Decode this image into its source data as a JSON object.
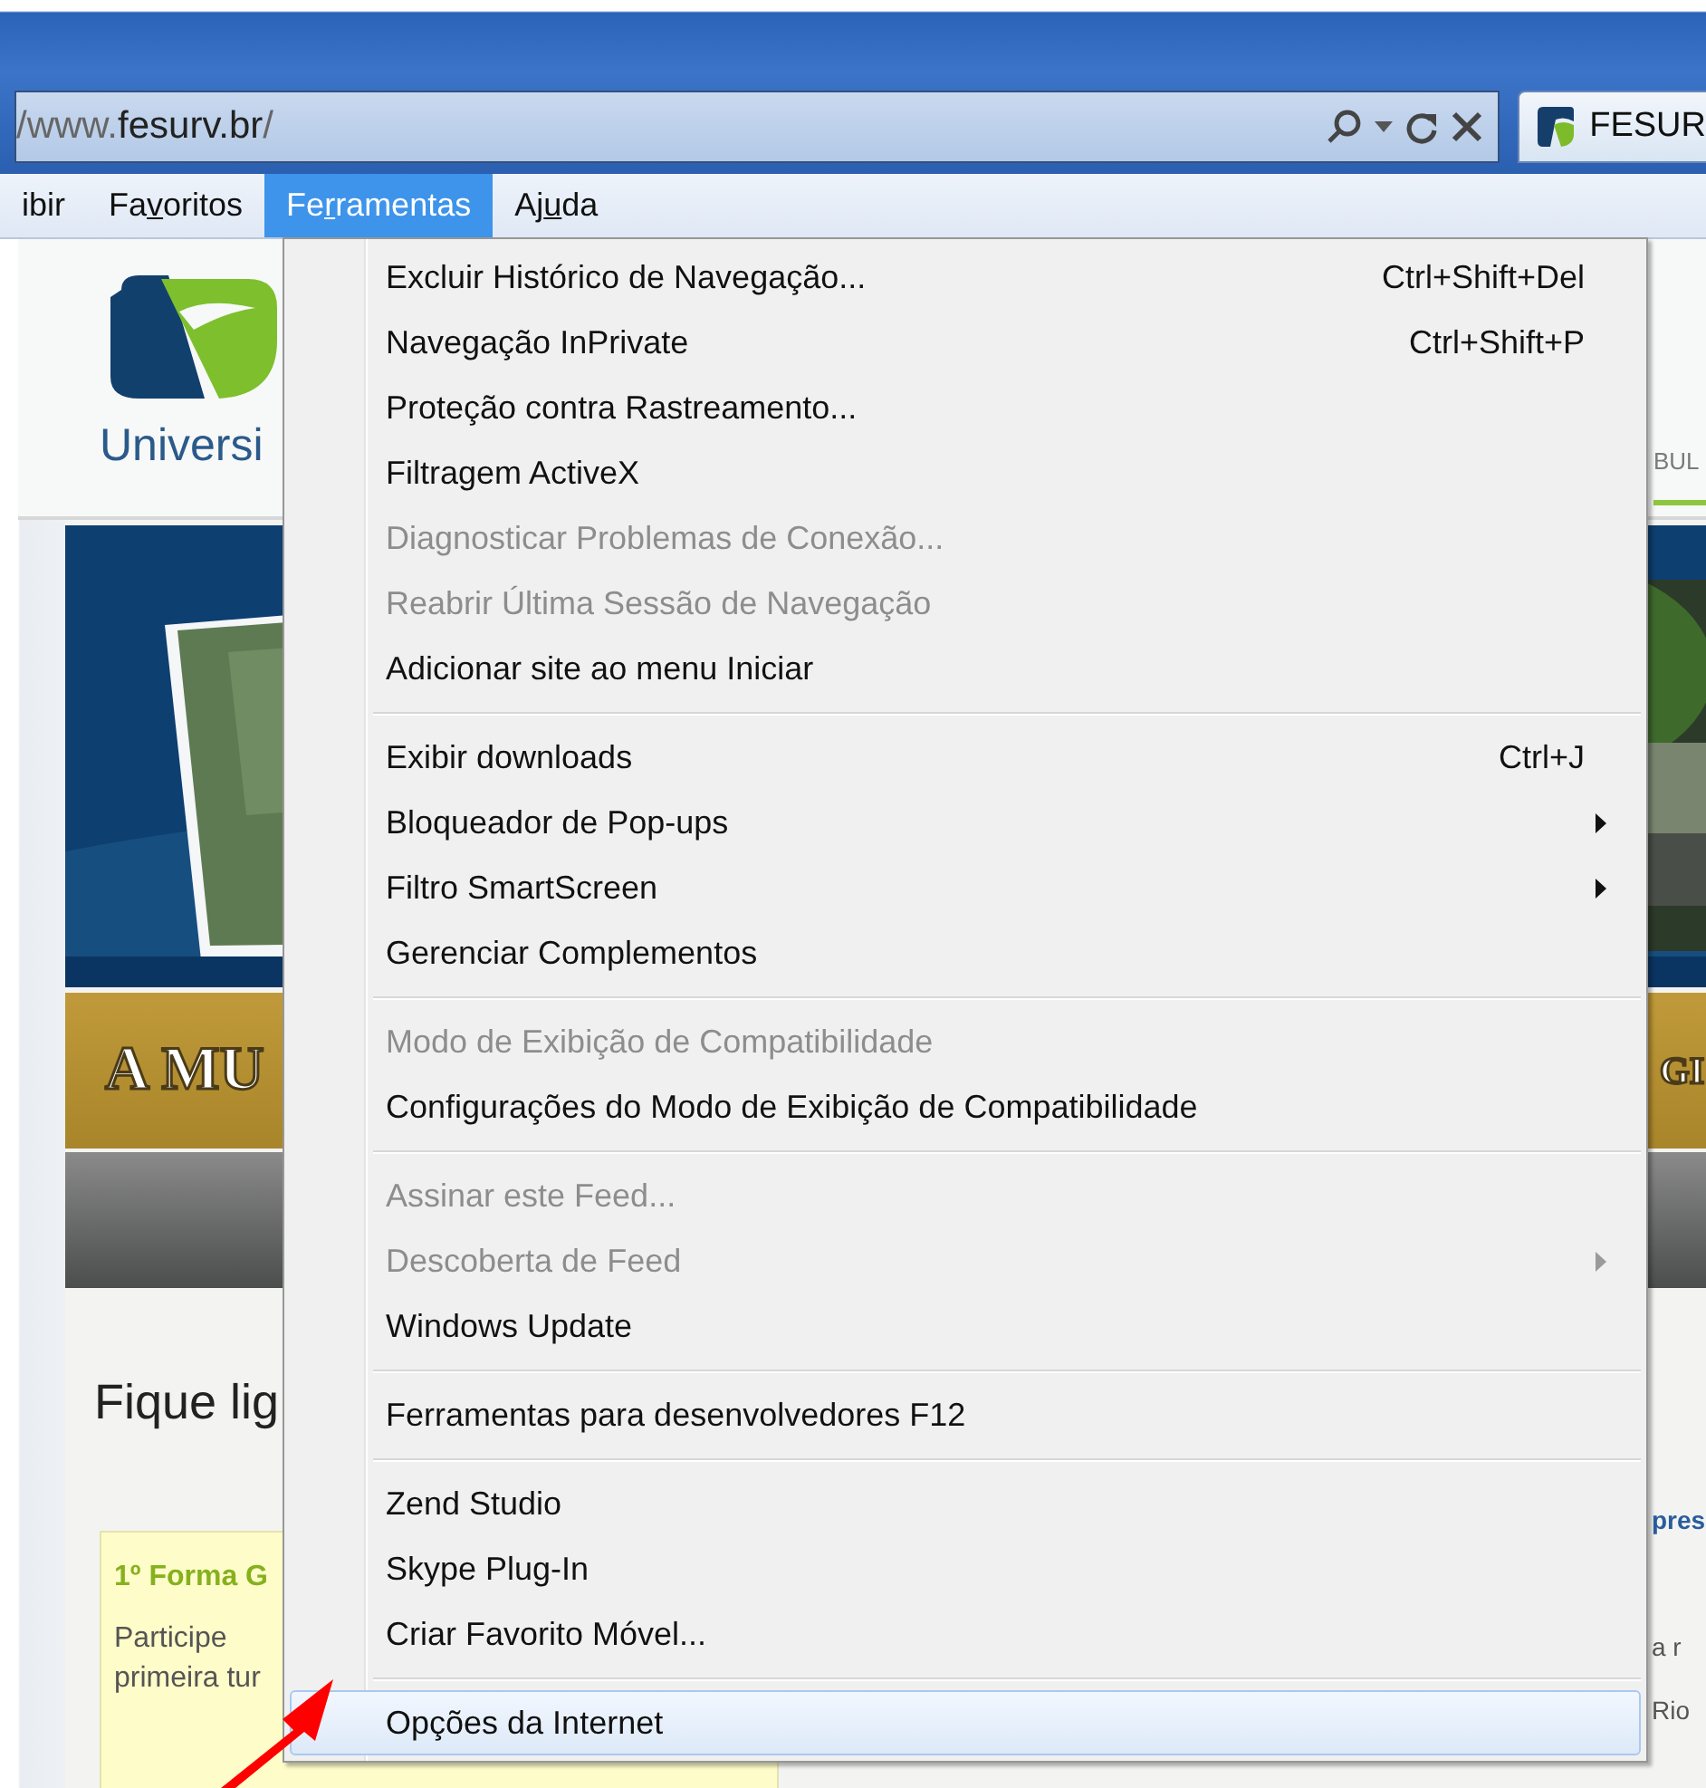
{
  "address_bar": {
    "url": {
      "prefix": "/www.",
      "host": "fesurv.br",
      "suffix": "/"
    }
  },
  "tab": {
    "title": "FESUR"
  },
  "menu_bar": [
    {
      "text": "ibir",
      "selected": false
    },
    {
      "text": "Fa",
      "key": "v",
      "rest": "oritos",
      "selected": false
    },
    {
      "text": "Fe",
      "key": "r",
      "rest": "ramentas",
      "selected": true
    },
    {
      "text": "Aj",
      "key": "u",
      "rest": "da",
      "selected": false
    }
  ],
  "page": {
    "logo_text": "Universi",
    "header_right": "BUL",
    "banner_text": "A MU",
    "banner_text_right": "GI",
    "heading": "Fique lig",
    "note": {
      "title": "1º Forma G",
      "lines": [
        "Participe",
        "primeira tur"
      ]
    },
    "side_texts": [
      {
        "text": "pres",
        "kind": "link"
      },
      {
        "text": "a  r",
        "kind": "text"
      },
      {
        "text": "Rio",
        "kind": "text"
      }
    ]
  },
  "tools_menu": {
    "items": [
      {
        "kind": "item",
        "label": "Excluir Histórico de Navegação...",
        "shortcut": "Ctrl+Shift+Del",
        "disabled": false,
        "submenu": false,
        "selected": false
      },
      {
        "kind": "item",
        "label": "Navegação InPrivate",
        "shortcut": "Ctrl+Shift+P",
        "disabled": false,
        "submenu": false,
        "selected": false
      },
      {
        "kind": "item",
        "label": "Proteção contra Rastreamento...",
        "disabled": false,
        "submenu": false,
        "selected": false
      },
      {
        "kind": "item",
        "label": "Filtragem ActiveX",
        "disabled": false,
        "submenu": false,
        "selected": false
      },
      {
        "kind": "item",
        "label": "Diagnosticar Problemas de Conexão...",
        "disabled": true,
        "submenu": false,
        "selected": false
      },
      {
        "kind": "item",
        "label": "Reabrir Última Sessão de Navegação",
        "disabled": true,
        "submenu": false,
        "selected": false
      },
      {
        "kind": "item",
        "label": "Adicionar site ao menu Iniciar",
        "disabled": false,
        "submenu": false,
        "selected": false
      },
      {
        "kind": "separator"
      },
      {
        "kind": "item",
        "label": "Exibir downloads",
        "shortcut": "Ctrl+J",
        "disabled": false,
        "submenu": false,
        "selected": false
      },
      {
        "kind": "item",
        "label": "Bloqueador de Pop-ups",
        "disabled": false,
        "submenu": true,
        "selected": false
      },
      {
        "kind": "item",
        "label": "Filtro SmartScreen",
        "disabled": false,
        "submenu": true,
        "selected": false
      },
      {
        "kind": "item",
        "label": "Gerenciar Complementos",
        "disabled": false,
        "submenu": false,
        "selected": false
      },
      {
        "kind": "separator"
      },
      {
        "kind": "item",
        "label": "Modo de Exibição de Compatibilidade",
        "disabled": true,
        "submenu": false,
        "selected": false
      },
      {
        "kind": "item",
        "label": "Configurações do Modo de Exibição de Compatibilidade",
        "disabled": false,
        "submenu": false,
        "selected": false
      },
      {
        "kind": "separator"
      },
      {
        "kind": "item",
        "label": "Assinar este Feed...",
        "disabled": true,
        "submenu": false,
        "selected": false
      },
      {
        "kind": "item",
        "label": "Descoberta de Feed",
        "disabled": true,
        "submenu": true,
        "selected": false
      },
      {
        "kind": "item",
        "label": "Windows Update",
        "disabled": false,
        "submenu": false,
        "selected": false
      },
      {
        "kind": "separator"
      },
      {
        "kind": "item",
        "label": "Ferramentas para desenvolvedores F12",
        "disabled": false,
        "submenu": false,
        "selected": false
      },
      {
        "kind": "separator"
      },
      {
        "kind": "item",
        "label": "Zend Studio",
        "disabled": false,
        "submenu": false,
        "selected": false
      },
      {
        "kind": "item",
        "label": "Skype Plug-In",
        "disabled": false,
        "submenu": false,
        "selected": false
      },
      {
        "kind": "item",
        "label": "Criar Favorito Móvel...",
        "disabled": false,
        "submenu": false,
        "selected": false
      },
      {
        "kind": "separator"
      },
      {
        "kind": "item",
        "label": "Opções da Internet",
        "disabled": false,
        "submenu": false,
        "selected": true
      }
    ]
  }
}
